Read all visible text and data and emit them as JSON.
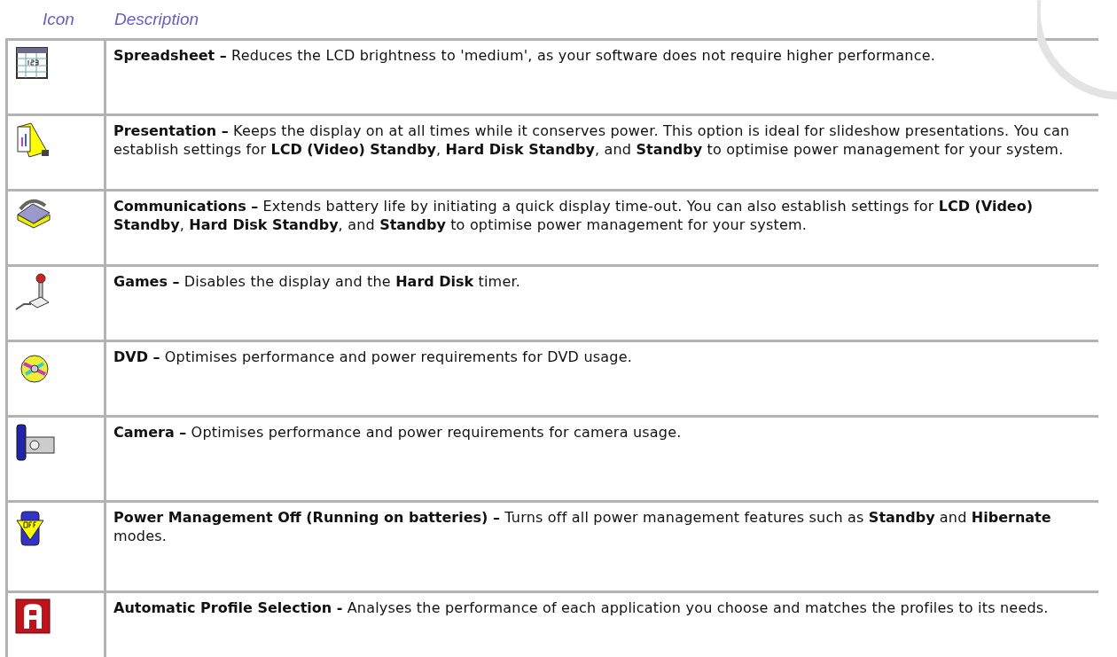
{
  "header": {
    "column_1": "Icon",
    "column_2": "Description"
  },
  "rows": [
    {
      "kind": "spreadsheet",
      "text": "**Spreadsheet –** Reduces the LCD brightness to 'medium', as your software does not require higher performance."
    },
    {
      "kind": "presentation",
      "text": "**Presentation –** Keeps the display on at all times while it conserves power. This option is ideal for slideshow presentations. You can establish settings for **LCD (Video) Standby**, **Hard Disk Standby**, and **Standby** to optimise power management for your system."
    },
    {
      "kind": "telephone",
      "text": "**Communications –** Extends battery life by initiating a quick display time-out. You can also establish settings for **LCD (Video) Standby**, **Hard Disk Standby**, and **Standby** to optimise power management for your system."
    },
    {
      "kind": "joystick",
      "text": "**Games –** Disables the display and the **Hard Disk** timer."
    },
    {
      "kind": "disc",
      "text": "**DVD –** Optimises performance and power requirements for DVD usage."
    },
    {
      "kind": "camera",
      "text": "**Camera –** Optimises performance and power requirements for camera usage."
    },
    {
      "kind": "battery",
      "text": "**Power Management Off  (Running on batteries) –** Turns off all power management features such as **Standby** and **Hibernate** modes."
    },
    {
      "kind": "letter",
      "text": "**Automatic Profile Selection -** Analyses the performance of each application you choose and matches the profiles to its needs."
    }
  ]
}
